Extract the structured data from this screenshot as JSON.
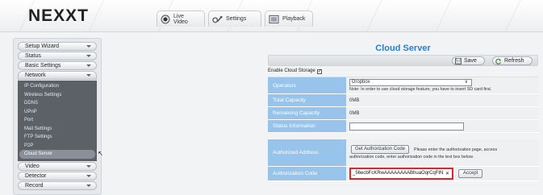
{
  "brand": {
    "logo_text": "NEXXT"
  },
  "top_tabs": [
    {
      "label": "Live Video",
      "icon": "camera-icon"
    },
    {
      "label": "Settings",
      "icon": "gear-icon"
    },
    {
      "label": "Playback",
      "icon": "film-icon"
    }
  ],
  "sidebar": {
    "items_before": [
      "Setup Wizard",
      "Status",
      "Basic Settings"
    ],
    "network": {
      "label": "Network",
      "subitems": [
        "IP Configuration",
        "Wireless Settings",
        "DDNS",
        "UPnP",
        "Port",
        "Mail Settings",
        "FTP Settings",
        "P2P",
        "Cloud Server"
      ],
      "active": "Cloud Server"
    },
    "items_after": [
      "Video",
      "Detector",
      "Record"
    ]
  },
  "page": {
    "title": "Cloud Server",
    "save_label": "Save",
    "refresh_label": "Refresh",
    "enable_label": "Enable Cloud Storage",
    "enable_checked": true
  },
  "form": {
    "operators_label": "Operators",
    "operator_value": "Dropbox",
    "operator_note": "Note: In order to use cloud storage feature, you have to insert SD card first.",
    "total_capacity_label": "Total Capacity",
    "total_capacity_value": "0MB",
    "remaining_capacity_label": "Remaining Capacity",
    "remaining_capacity_value": "0MB",
    "status_label": "Status Information",
    "status_value": "",
    "authorized_address_label": "Authorized Address",
    "get_code_button": "Get Authorization Code",
    "auth_instructions_1": "Please enter the authorization page, access",
    "auth_instructions_2": "authorization code, enter authorization code in the text box below.",
    "auth_code_label": "Authorization Code",
    "auth_code_value": "_56ecbFcKRwAAAAAAAABhuaOqrCqFtN3Z",
    "accept_button": "Accept"
  }
}
